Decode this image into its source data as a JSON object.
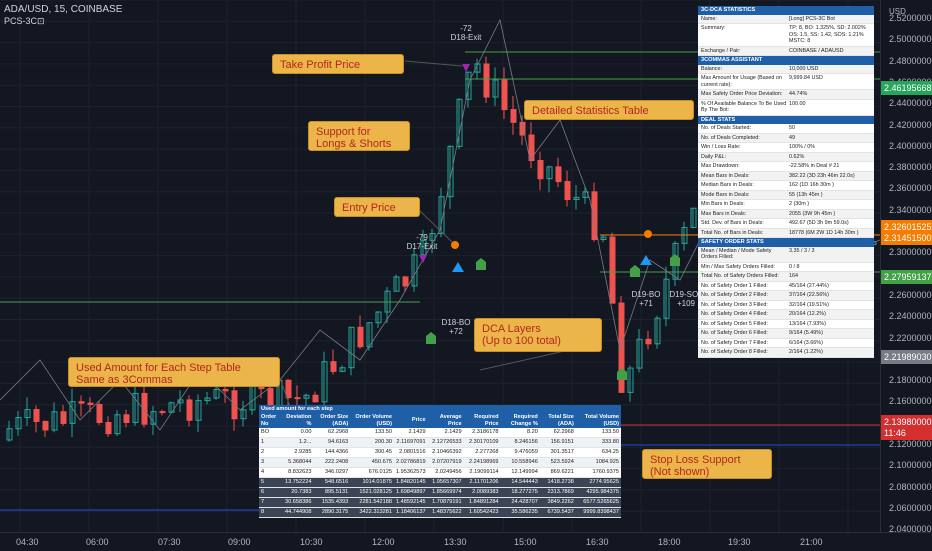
{
  "header": {
    "symbol_line": "ADA/USD, 15, COINBASE",
    "indicator": "PCS-3C⊡"
  },
  "price_axis": {
    "unit": "USD",
    "ticks": [
      "2.52000000",
      "2.50000000",
      "2.48000000",
      "2.46000000",
      "2.44000000",
      "2.42000000",
      "2.40000000",
      "2.38000000",
      "2.36000000",
      "2.34000000",
      "2.32000000",
      "2.30000000",
      "2.28000000",
      "2.26000000",
      "2.24000000",
      "2.22000000",
      "2.20000000",
      "2.18000000",
      "2.16000000",
      "2.14000000",
      "2.12000000",
      "2.10000000",
      "2.08000000",
      "2.06000000",
      "2.04000000"
    ],
    "tags": [
      {
        "label": "2.46195668",
        "color": "#26a65b"
      },
      {
        "label": "2.32601525",
        "color": "#f57c00"
      },
      {
        "label": "2.31451500",
        "color": "#f57c00"
      },
      {
        "label": "2.27959137",
        "color": "#43a047"
      },
      {
        "label": "2.21989030",
        "color": "#787b86"
      },
      {
        "label": "2.13980000",
        "color": "#d32f2f"
      },
      {
        "label": "11:46",
        "color": "#d32f2f"
      }
    ]
  },
  "time_axis": [
    "04:30",
    "06:00",
    "07:30",
    "09:00",
    "10:30",
    "12:00",
    "13:30",
    "15:00",
    "16:30",
    "18:00",
    "19:30",
    "21:00"
  ],
  "callouts": {
    "take_profit": "Take Profit Price",
    "support": "Support for\nLongs & Shorts",
    "entry": "Entry Price",
    "detailed_stats": "Detailed Statistics Table",
    "dca_layers": "DCA Layers\n(Up to 100 total)",
    "used_amount": "Used Amount for Each Step Table\nSame as 3Commas",
    "stop_loss": "Stop Loss Support\n(Not shown)"
  },
  "markers": {
    "m1": "-72\nD18-Exit",
    "m2": "-79\nD17-Exit",
    "m3": "D18-BO\n+72",
    "m4": "D19-BO\n+71",
    "m5": "D19-SO1\n+109"
  },
  "stats": {
    "sections": [
      {
        "title": "3C-DCA STATISTICS",
        "rows": [
          [
            "Name:",
            "[Long] PCS-3C Bot"
          ],
          [
            "Summary:",
            "TP: 8, BO: 1.325%, SD: 2.002% OS: 1.5, SS: 1.42, SOS: 1.21% MSTC: 8"
          ],
          [
            "Exchange / Pair:",
            "COINBASE / ADAUSD"
          ]
        ]
      },
      {
        "title": "3COMMAS ASSISTANT",
        "rows": [
          [
            "Balance:",
            "10,000 USD"
          ],
          [
            "Max Amount for Usage (Based on current rate):",
            "9,999.84 USD"
          ],
          [
            "Max Safety Order Price Deviation:",
            "44.74%"
          ],
          [
            "% Of Available Balance To Be Used By The Bot:",
            "100.00"
          ]
        ]
      },
      {
        "title": "DEAL STATS",
        "rows": [
          [
            "No. of Deals Started:",
            "50"
          ],
          [
            "No. of Deals Completed:",
            "49"
          ],
          [
            "Win / Loss Rate:",
            "100% / 0%"
          ],
          [
            "Daily P&L:",
            "0.62%"
          ],
          [
            "Max Drawdown:",
            "-22.58% in Deal # 21"
          ],
          [
            "Mean Bars in Deals:",
            "382.22 (3D 23h 46m 22.0s)"
          ],
          [
            "Median Bars in Deals:",
            "162 (1D 16h 30m )"
          ],
          [
            "Mode Bars in Deals:",
            "55 (13h 45m )"
          ],
          [
            "Min Bars in Deals:",
            "2 (30m )"
          ],
          [
            "Max Bars in Deals:",
            "2055 (3W 9h 45m )"
          ],
          [
            "Std. Dev. of Bars in Deals:",
            "492.67 (5D 3h 9m 59.0s)"
          ],
          [
            "Total No. of Bars in Deals:",
            "18778 (6M 2W 1D 14h 30m )"
          ]
        ]
      },
      {
        "title": "SAFETY ORDER STATS",
        "rows": [
          [
            "Mean / Median / Mode Safety Orders Filled:",
            "3.35 / 3 / 3"
          ],
          [
            "Min / Max Safety Orders Filled:",
            "0 / 8"
          ],
          [
            "Total No. of Safety Orders Filled:",
            "164"
          ],
          [
            "No. of Safety Order 1 Filled:",
            "45/164 (27.44%)"
          ],
          [
            "No. of Safety Order 2 Filled:",
            "37/164 (22.56%)"
          ],
          [
            "No. of Safety Order 3 Filled:",
            "32/164 (19.51%)"
          ],
          [
            "No. of Safety Order 4 Filled:",
            "20/164 (12.2%)"
          ],
          [
            "No. of Safety Order 5 Filled:",
            "13/164 (7.93%)"
          ],
          [
            "No. of Safety Order 6 Filled:",
            "9/164 (5.49%)"
          ],
          [
            "No. of Safety Order 7 Filled:",
            "6/164 (3.66%)"
          ],
          [
            "No. of Safety Order 8 Filled:",
            "2/164 (1.22%)"
          ]
        ]
      }
    ]
  },
  "table": {
    "caption": "Used   amount for   each step",
    "headers": [
      "Order No",
      "Deviation %",
      "Order Size (ADA)",
      "Order Volume (USD)",
      "Price",
      "Average Price",
      "Required Price",
      "Required Change %",
      "Total Size (ADA)",
      "Total Volume (USD)"
    ],
    "rows": [
      [
        "BO",
        "0.00",
        "62.2968",
        "133.50",
        "2.1429",
        "2.1429",
        "2.3186178",
        "8.20",
        "62.2968",
        "133.50"
      ],
      [
        "1",
        "1.2...",
        "94.6163",
        "200.30",
        "2.11697091",
        "2.12726533",
        "2.30170109",
        "8.246156",
        "156.9151",
        "333.80"
      ],
      [
        "2",
        "2.9285",
        "144.4366",
        "300.45",
        "2.0801516",
        "2.10466392",
        "2.277268",
        "9.476059",
        "301.3517",
        "634.25"
      ],
      [
        "3",
        "5.368044",
        "222.2408",
        "450.675",
        "2.02786819",
        "2.07207919",
        "2.24198969",
        "10.558946",
        "523.5924",
        "1084.925"
      ],
      [
        "4",
        "8.832623",
        "346.0297",
        "676.0125",
        "1.95362573",
        "2.0249456",
        "2.19099114",
        "12.149994",
        "869.6221",
        "1760.9375"
      ],
      [
        "5",
        "13.752224",
        "548.6516",
        "1014.01875",
        "1.84820145",
        "1.95657307",
        "2.11701206",
        "14.544443",
        "1418.2738",
        "2774.95625"
      ],
      [
        "6",
        "20.7383",
        "895.5131",
        "1521.028125",
        "1.69849897",
        "1.85669974",
        "2.0089383",
        "18.277275",
        "2313.7869",
        "4295.984375"
      ],
      [
        "7",
        "30.658386",
        "1535.4393",
        "2281.542188",
        "1.48592145",
        "1.70879191",
        "1.84891284",
        "24.428707",
        "3849.2262",
        "6577.5265625"
      ],
      [
        "8",
        "44.744908",
        "2890.3175",
        "3422.313281",
        "1.18406137",
        "1.48375622",
        "1.60542423",
        "35.586235",
        "6739.5437",
        "9999.8398437"
      ]
    ]
  }
}
